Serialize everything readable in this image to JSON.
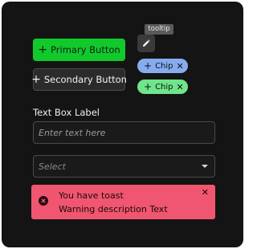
{
  "buttons": {
    "primary_label": "Primary Button",
    "secondary_label": "Secondary Button",
    "plus_glyph": "+"
  },
  "icon_button": {
    "icon": "pencil-icon",
    "tooltip": "tooltip"
  },
  "chips": [
    {
      "label": "Chip",
      "color": "#86acf0"
    },
    {
      "label": "Chip",
      "color": "#6fe58c"
    }
  ],
  "chip_glyphs": {
    "plus": "+",
    "close": "✕"
  },
  "textbox": {
    "label": "Text Box Label",
    "placeholder": "Enter text here",
    "value": ""
  },
  "select": {
    "selected": "Select"
  },
  "toast": {
    "title": "You have toast",
    "description": "Warning description Text",
    "close_glyph": "✕",
    "color": "#f0566f"
  },
  "colors": {
    "background": "#141414",
    "primary": "#12c92c"
  }
}
